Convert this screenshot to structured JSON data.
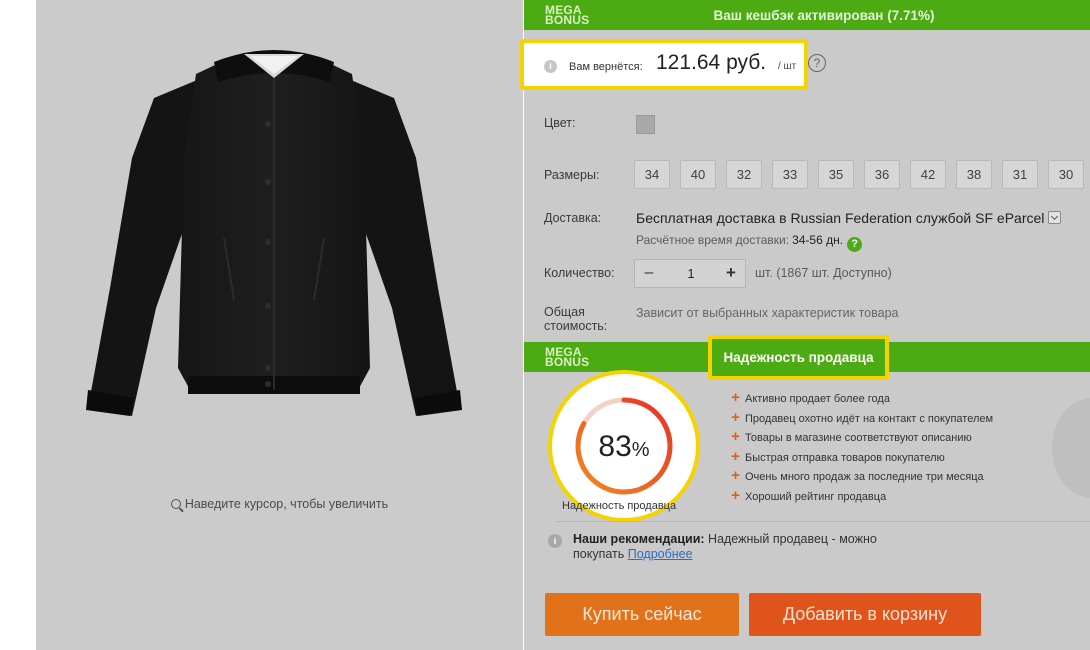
{
  "product": {
    "zoom_hint": "Наведите курсор, чтобы увеличить"
  },
  "megabonus": {
    "logo_line1": "MEGA",
    "logo_line2": "BONUS",
    "cashback_title": "Ваш кешбэк активирован (7.71%)",
    "return_label": "Вам вернётся:",
    "return_value": "121.64 руб.",
    "return_unit": "/ шт",
    "info_icon": "info-icon",
    "help_icon": "question-mark-icon"
  },
  "options": {
    "color_label": "Цвет:",
    "sizes_label": "Размеры:",
    "sizes": [
      "34",
      "40",
      "32",
      "33",
      "35",
      "36",
      "42",
      "38",
      "31",
      "30"
    ],
    "delivery_label": "Доставка:",
    "delivery_text": "Бесплатная доставка в Russian Federation службой SF eParcel",
    "delivery_time_label": "Расчётное время доставки:",
    "delivery_time_value": "34-56 дн.",
    "delivery_help": "?",
    "quantity_label": "Количество:",
    "quantity_minus": "–",
    "quantity_value": "1",
    "quantity_plus": "+",
    "quantity_available": "шт. (1867 шт. Доступно)",
    "total_label_line1": "Общая",
    "total_label_line2": "стоимость:",
    "total_note": "Зависит от выбранных характеристик товара"
  },
  "seller": {
    "title": "Надежность продавца",
    "score": 83,
    "score_num": "83",
    "score_unit": "%",
    "score_caption": "Надежность продавца",
    "bullets": [
      "Активно продает более года",
      "Продавец охотно идёт на контакт с покупателем",
      "Товары в магазине соответствуют описанию",
      "Быстрая отправка товаров покупателю",
      "Очень много продаж за последние три месяца",
      "Хороший рейтинг продавца"
    ],
    "rec_label": "Наши рекомендации:",
    "rec_text": " Надежный продавец - можно покупать ",
    "rec_link": "Подробнее"
  },
  "actions": {
    "buy_now": "Купить сейчас",
    "add_to_cart": "Добавить в корзину"
  },
  "colors": {
    "megabonus_green": "#4caa12",
    "highlight_yellow": "#f5d300",
    "buy_orange": "#e1721a",
    "cart_orange": "#e0531a",
    "gauge_red": "#e8342a"
  }
}
